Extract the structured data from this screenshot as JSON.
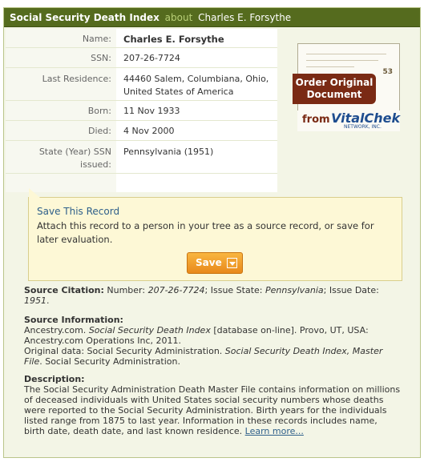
{
  "header": {
    "title": "Social Security Death Index",
    "about": "about",
    "person": "Charles E. Forsythe"
  },
  "record": {
    "rows": [
      {
        "label": "Name:",
        "value": "Charles E. Forsythe"
      },
      {
        "label": "SSN:",
        "value": "207-26-7724"
      },
      {
        "label": "Last Residence:",
        "value": "44460  Salem, Columbiana, Ohio, United States of America"
      },
      {
        "label": "Born:",
        "value": "11 Nov 1933"
      },
      {
        "label": "Died:",
        "value": "4 Nov 2000"
      },
      {
        "label": "State (Year) SSN issued:",
        "value": "Pennsylvania (1951)"
      }
    ]
  },
  "promo": {
    "banner": "Order Original Document",
    "from": "from",
    "brand": "VitalChek",
    "network": "NETWORK, INC.",
    "doc_number": "53"
  },
  "save": {
    "title": "Save This Record",
    "description": "Attach this record to a person in your tree as a source record, or save for later evaluation.",
    "button_label": "Save"
  },
  "citation": {
    "heading": "Source Citation:",
    "number_label": "Number:",
    "number": "207-26-7724",
    "state_label": "; Issue State:",
    "state": "Pennsylvania",
    "date_label": "; Issue Date:",
    "date": "1951"
  },
  "source_info": {
    "heading": "Source Information:",
    "line1_a": "Ancestry.com.",
    "line1_title": "Social Security Death Index",
    "line1_b": "[database on-line]. Provo, UT, USA: Ancestry.com Operations Inc, 2011.",
    "line2_a": "Original data: Social Security Administration.",
    "line2_title": "Social Security Death Index, Master File",
    "line2_b": ". Social Security Administration."
  },
  "description": {
    "heading": "Description:",
    "text": "The Social Security Administration Death Master File contains information on millions of deceased individuals with United States social security numbers whose deaths were reported to the Social Security Administration. Birth years for the individuals listed range from 1875 to last year. Information in these records includes name, birth date, death date, and last known residence.",
    "link": "Learn more..."
  },
  "colors": {
    "header_bg": "#556b1e",
    "panel_bg": "#f3f5e6",
    "save_bg": "#fdf8d6",
    "button": "#f0a030",
    "link": "#2e5f8a"
  }
}
